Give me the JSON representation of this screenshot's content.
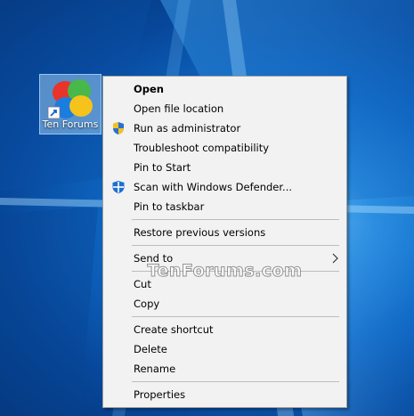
{
  "desktop": {
    "icon_label": "Ten Forums"
  },
  "menu": {
    "open": "Open",
    "open_file_location": "Open file location",
    "run_as_admin": "Run as administrator",
    "troubleshoot": "Troubleshoot compatibility",
    "pin_to_start": "Pin to Start",
    "scan_defender": "Scan with Windows Defender...",
    "pin_to_taskbar": "Pin to taskbar",
    "restore_versions": "Restore previous versions",
    "send_to": "Send to",
    "cut": "Cut",
    "copy": "Copy",
    "create_shortcut": "Create shortcut",
    "delete": "Delete",
    "rename": "Rename",
    "properties": "Properties"
  },
  "watermark": "TenForums.com",
  "colors": {
    "menu_background": "#f2f2f2",
    "desktop_blue": "#0f68c4"
  }
}
